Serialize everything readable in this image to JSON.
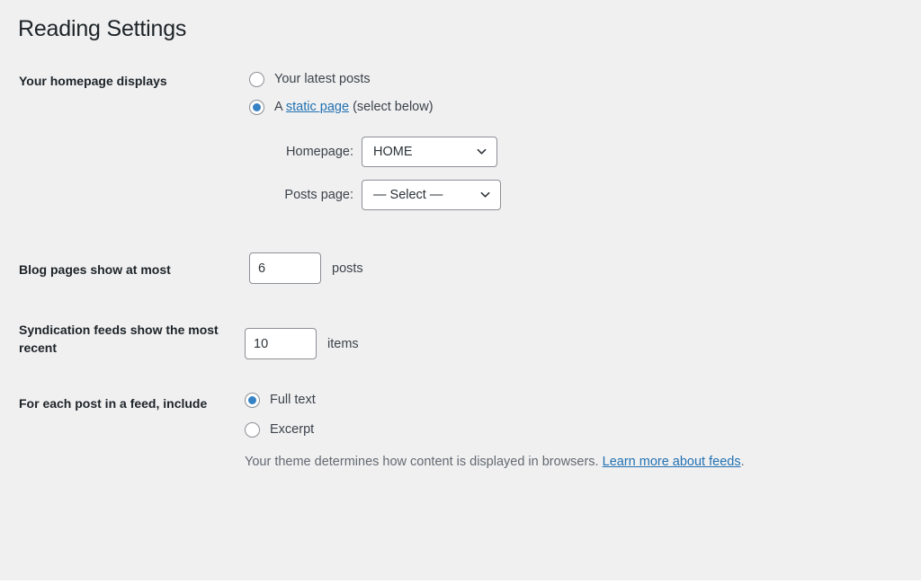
{
  "page": {
    "title": "Reading Settings",
    "background_color": "#f0f0f1",
    "link_color": "#2271b1",
    "accent_color": "#3582c4"
  },
  "homepage_displays": {
    "label": "Your homepage displays",
    "options": [
      {
        "label": "Your latest posts",
        "selected": false
      },
      {
        "label_prefix": "A ",
        "link_label": "static page",
        "label_suffix": " (select below)",
        "selected": true
      }
    ],
    "homepage_select": {
      "label": "Homepage:",
      "value": "HOME",
      "icon": "chevron-down-icon"
    },
    "posts_page_select": {
      "label": "Posts page:",
      "value": "— Select —",
      "icon": "chevron-down-icon"
    }
  },
  "blog_pages": {
    "label": "Blog pages show at most",
    "value": "6",
    "suffix": "posts"
  },
  "syndication_feeds": {
    "label": "Syndication feeds show the most recent",
    "value": "10",
    "suffix": "items"
  },
  "feed_include": {
    "label": "For each post in a feed, include",
    "options": [
      {
        "label": "Full text",
        "selected": true
      },
      {
        "label": "Excerpt",
        "selected": false
      }
    ],
    "help_prefix": "Your theme determines how content is displayed in browsers. ",
    "help_link": "Learn more about feeds",
    "help_suffix": "."
  }
}
